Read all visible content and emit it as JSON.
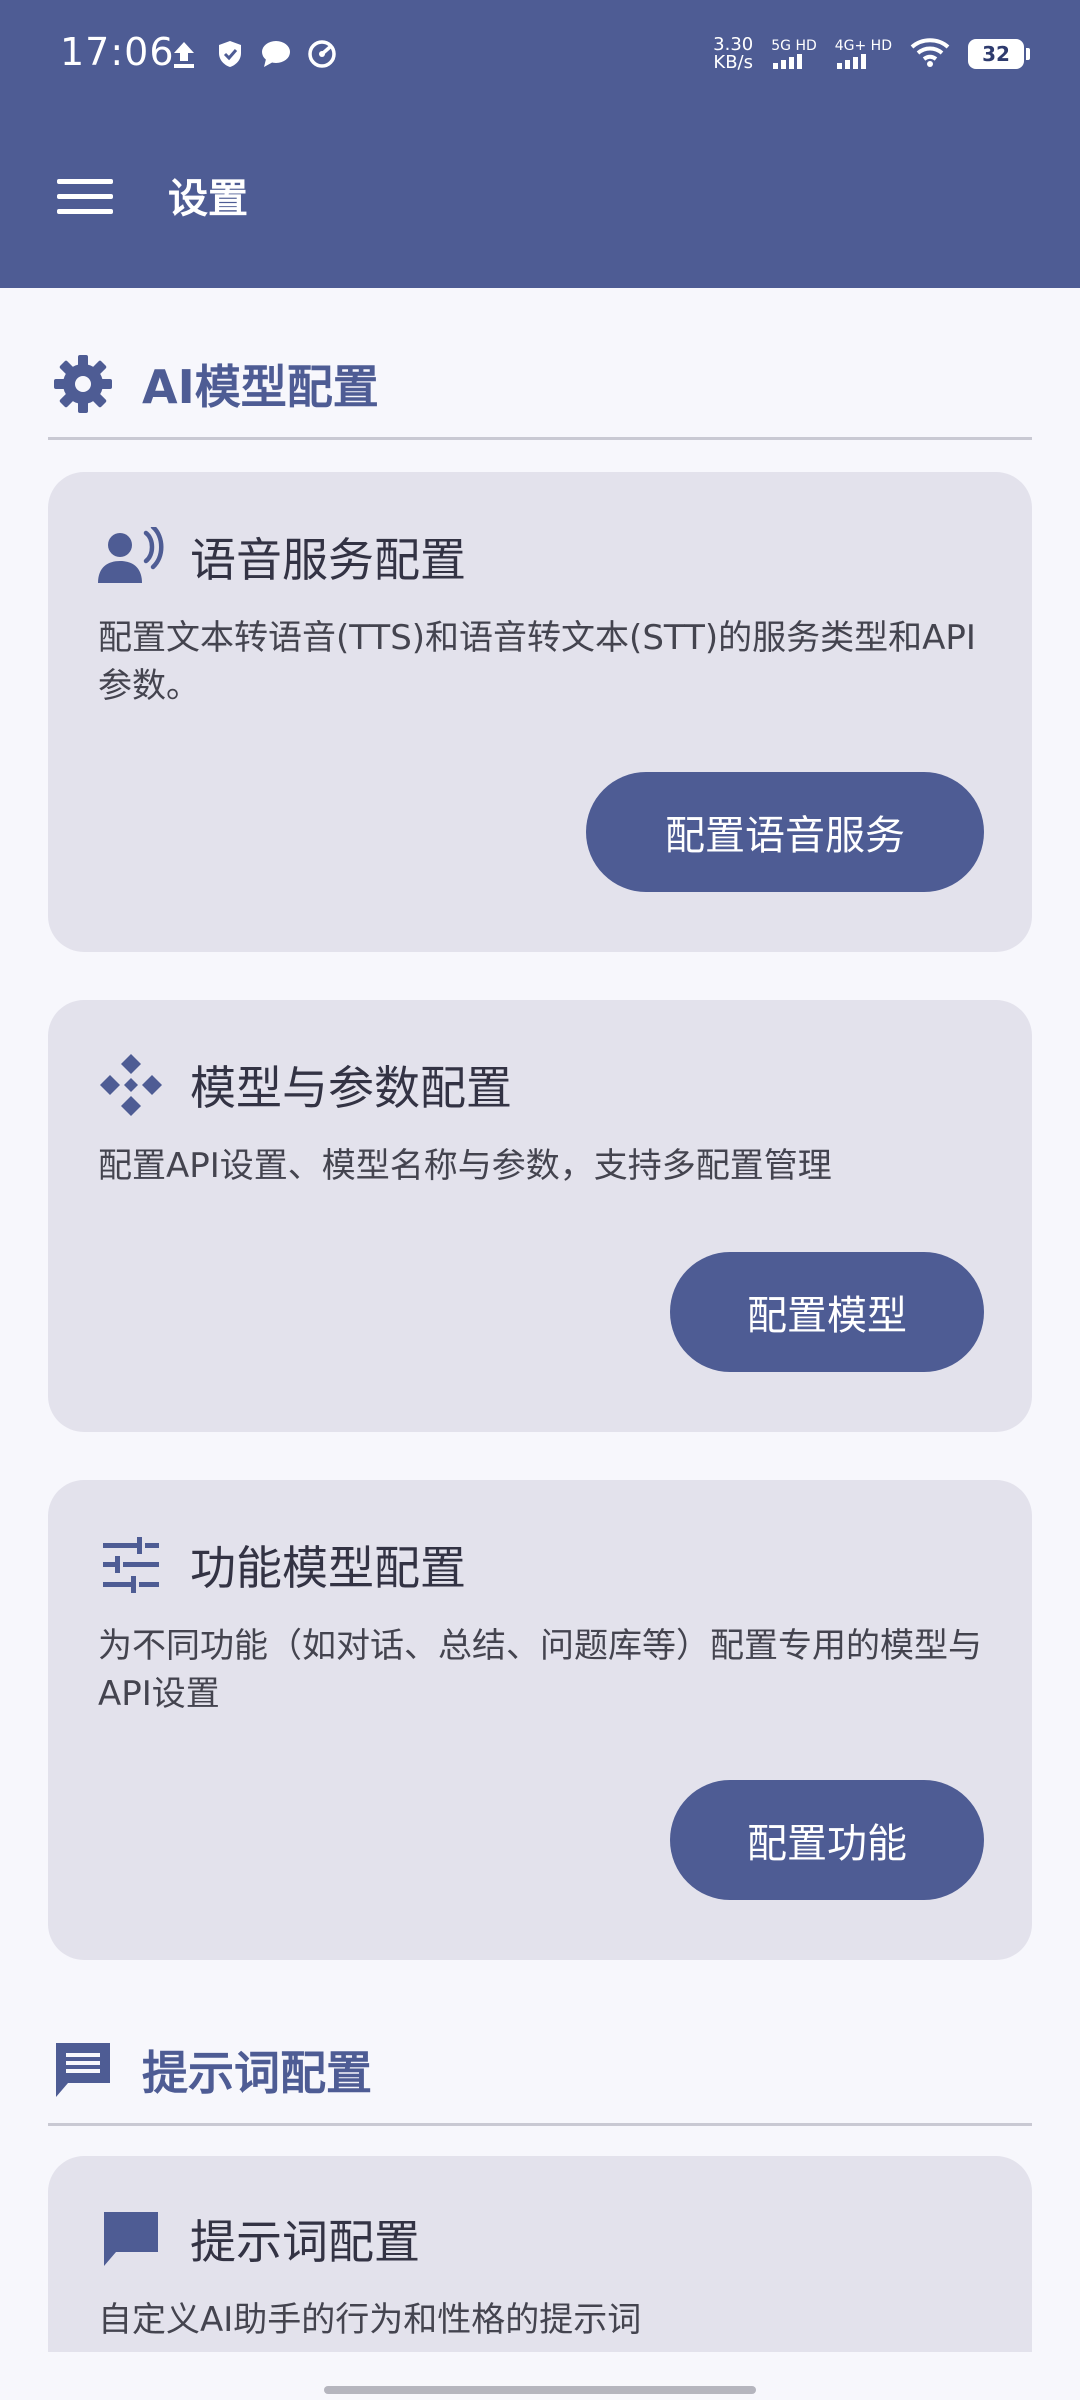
{
  "status_bar": {
    "time": "17:06",
    "net_speed_value": "3.30",
    "net_speed_unit": "KB/s",
    "sim1_label": "5G HD",
    "sim2_label": "4G+ HD",
    "battery": "32"
  },
  "toolbar": {
    "title": "设置"
  },
  "sections": [
    {
      "title": "AI模型配置",
      "cards": [
        {
          "title": "语音服务配置",
          "description": "配置文本转语音(TTS)和语音转文本(STT)的服务类型和API参数。",
          "button": "配置语音服务"
        },
        {
          "title": "模型与参数配置",
          "description": "配置API设置、模型名称与参数，支持多配置管理",
          "button": "配置模型"
        },
        {
          "title": "功能模型配置",
          "description": "为不同功能（如对话、总结、问题库等）配置专用的模型与API设置",
          "button": "配置功能"
        }
      ]
    },
    {
      "title": "提示词配置",
      "cards": [
        {
          "title": "提示词配置",
          "description": "自定义AI助手的行为和性格的提示词"
        }
      ]
    }
  ],
  "colors": {
    "primary": "#4E5C94",
    "background": "#F7F7FC",
    "card": "#E3E2EC"
  }
}
